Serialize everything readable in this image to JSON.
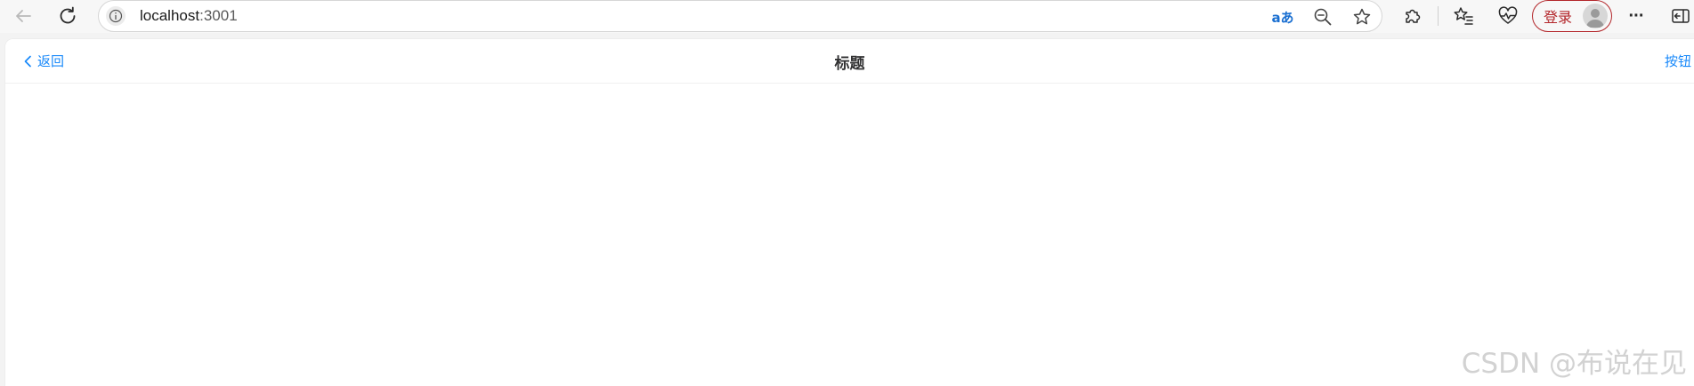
{
  "browser": {
    "address": {
      "host": "localhost",
      "port": ":3001"
    },
    "toolbar": {
      "translate_label": "aあ",
      "login_label": "登录",
      "more_label": "···"
    }
  },
  "page": {
    "header": {
      "back_label": "返回",
      "title": "标题",
      "right_button_label": "按钮"
    }
  },
  "watermark": "CSDN @布说在见",
  "colors": {
    "accent": "#1989fa",
    "login_border": "#b3262a",
    "title": "#323233"
  },
  "icons": {
    "back": "arrow-left-icon",
    "refresh": "refresh-icon",
    "site_info": "info-icon",
    "translate": "translate-icon",
    "zoom": "zoom-out-icon",
    "favorite": "star-icon",
    "extensions": "puzzle-icon",
    "favorites_list": "favorites-icon",
    "health": "heart-pulse-icon",
    "avatar": "avatar-icon",
    "more": "more-icon",
    "sidebar": "sidebar-icon",
    "header_back": "chevron-left-icon"
  }
}
